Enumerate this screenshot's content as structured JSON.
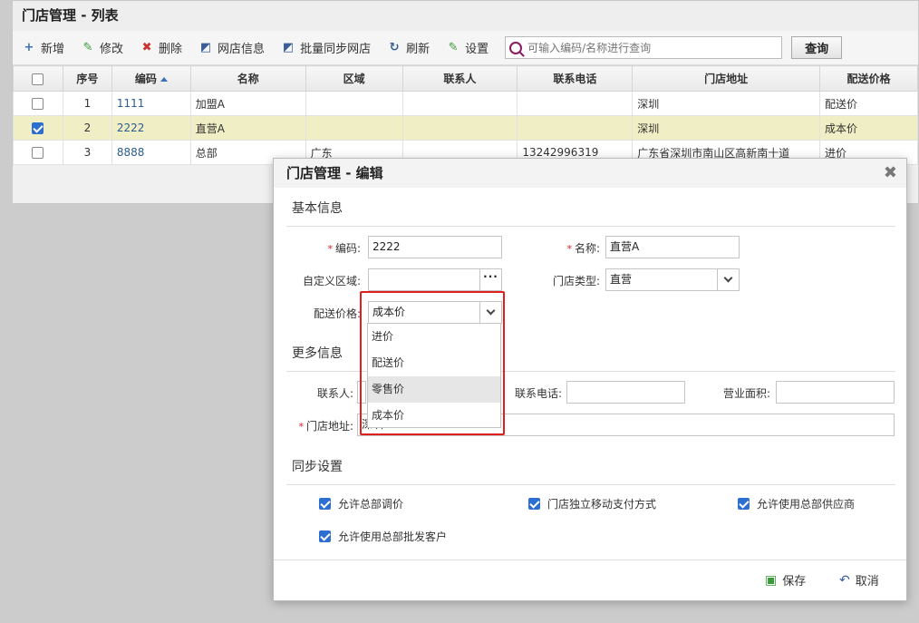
{
  "list": {
    "title": "门店管理 - 列表",
    "toolbar": {
      "add": "新增",
      "edit": "修改",
      "delete": "删除",
      "online_store": "网店信息",
      "batch_sync": "批量同步网店",
      "refresh": "刷新",
      "settings": "设置",
      "search_placeholder": "可输入编码/名称进行查询",
      "query": "查询"
    },
    "columns": [
      "序号",
      "编码",
      "名称",
      "区域",
      "联系人",
      "联系电话",
      "门店地址",
      "配送价格"
    ],
    "rows": [
      {
        "no": "1",
        "code": "1111",
        "name": "加盟A",
        "region": "",
        "contact": "",
        "phone": "",
        "address": "深圳",
        "price": "配送价",
        "checked": false
      },
      {
        "no": "2",
        "code": "2222",
        "name": "直营A",
        "region": "",
        "contact": "",
        "phone": "",
        "address": "深圳",
        "price": "成本价",
        "checked": true
      },
      {
        "no": "3",
        "code": "8888",
        "name": "总部",
        "region": "广东",
        "contact": "",
        "phone": "13242996319",
        "address": "广东省深圳市南山区高新南十道",
        "price": "进价",
        "checked": false
      }
    ]
  },
  "modal": {
    "title": "门店管理 - 编辑",
    "basic_section": "基本信息",
    "more_section": "更多信息",
    "sync_section": "同步设置",
    "fields": {
      "code_label": "编码:",
      "code_value": "2222",
      "name_label": "名称:",
      "name_value": "直营A",
      "region_label": "自定义区域:",
      "region_value": "",
      "store_type_label": "门店类型:",
      "store_type_value": "直营",
      "price_label": "配送价格:",
      "price_value": "成本价",
      "contact_label": "联系人:",
      "phone_label": "联系电话:",
      "area_label": "营业面积:",
      "address_label": "门店地址:",
      "address_value": "深圳"
    },
    "price_options": [
      "进价",
      "配送价",
      "零售价",
      "成本价"
    ],
    "sync_options": [
      {
        "label": "允许总部调价",
        "checked": true
      },
      {
        "label": "门店独立移动支付方式",
        "checked": true
      },
      {
        "label": "允许使用总部供应商",
        "checked": true
      },
      {
        "label": "允许使用总部批发客户",
        "checked": true
      }
    ],
    "save": "保存",
    "cancel": "取消"
  }
}
